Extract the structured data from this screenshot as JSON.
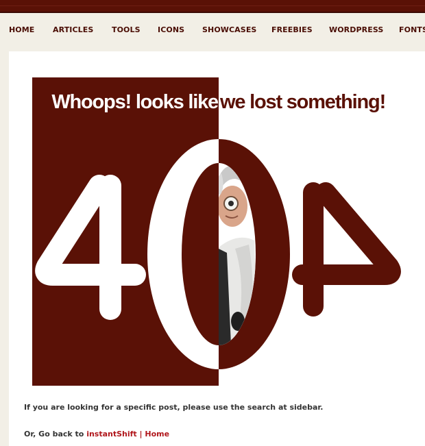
{
  "colors": {
    "brand": "#5a1106",
    "accent_link": "#b0161b",
    "page_bg": "#f2efe6"
  },
  "nav": {
    "items": [
      {
        "label": "HOME"
      },
      {
        "label": "ARTICLES"
      },
      {
        "label": "TOOLS"
      },
      {
        "label": "ICONS"
      },
      {
        "label": "SHOWCASES"
      },
      {
        "label": "FREEBIES"
      },
      {
        "label": "WORDPRESS"
      },
      {
        "label": "FONTS"
      }
    ]
  },
  "hero": {
    "headline_left": "Whoops! looks like",
    "headline_right": "we lost something!",
    "digits": [
      "4",
      "0",
      "4"
    ]
  },
  "content": {
    "line1": "If you are looking for a specific post, please use the search at sidebar.",
    "line2_prefix": "Or, Go back to ",
    "link_site": "instantShift",
    "separator": " | ",
    "link_home": "Home"
  }
}
